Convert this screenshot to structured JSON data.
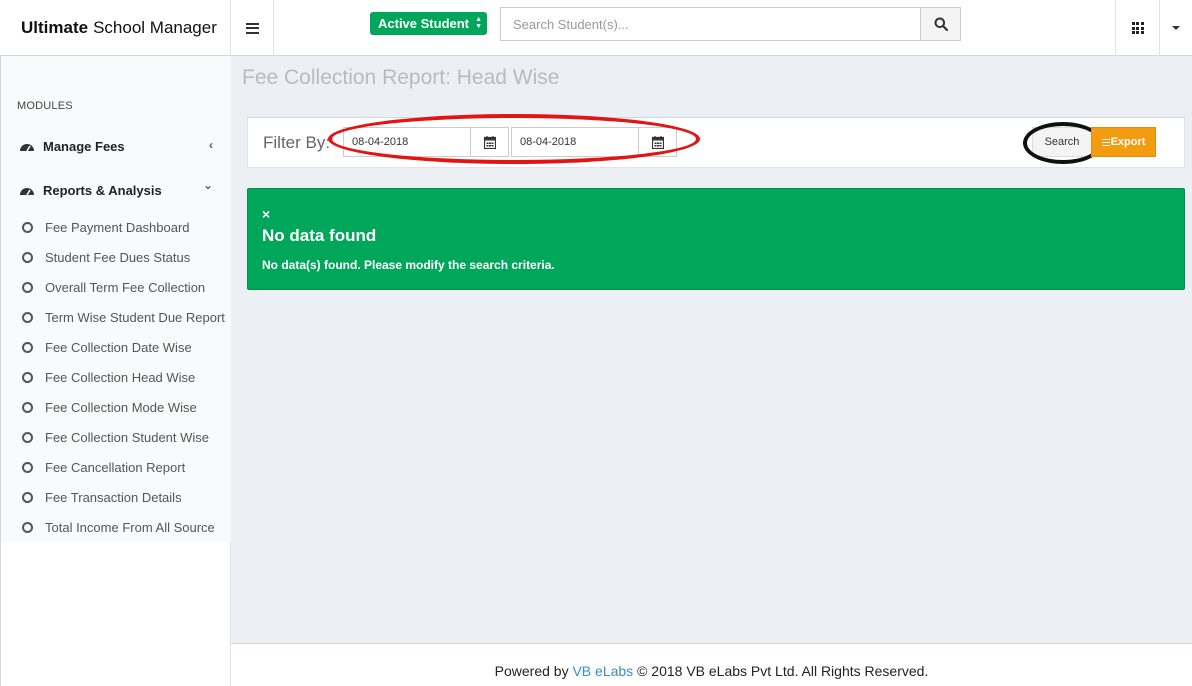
{
  "header": {
    "brand_bold": "Ultimate",
    "brand_rest": "School Manager",
    "status_select": "Active Student",
    "search_placeholder": "Search Student(s)...",
    "icons": [
      "menu-icon",
      "search-icon",
      "apps-grid-icon",
      "caret-down-icon"
    ]
  },
  "sidebar": {
    "section_title": "MODULES",
    "tree": [
      {
        "label": "Manage Fees",
        "chevron": "‹",
        "icon": "dashboard-icon"
      },
      {
        "label": "Reports & Analysis",
        "chevron": "⌄",
        "icon": "dashboard-icon"
      }
    ],
    "items": [
      {
        "label": "Fee Payment Dashboard"
      },
      {
        "label": "Student Fee Dues Status"
      },
      {
        "label": "Overall Term Fee Collection"
      },
      {
        "label": "Term Wise Student Due Report"
      },
      {
        "label": "Fee Collection Date Wise"
      },
      {
        "label": "Fee Collection Head Wise"
      },
      {
        "label": "Fee Collection Mode Wise"
      },
      {
        "label": "Fee Collection Student Wise"
      },
      {
        "label": "Fee Cancellation Report"
      },
      {
        "label": "Fee Transaction Details"
      },
      {
        "label": "Total Income From All Source"
      }
    ]
  },
  "main": {
    "page_title": "Fee Collection Report: Head Wise",
    "filter": {
      "label": "Filter By:",
      "from_date": "08-04-2018",
      "to_date": "08-04-2018",
      "search_label": "Search",
      "export_label": "Export"
    },
    "alert": {
      "close": "×",
      "title": "No data found",
      "message": "No data(s) found. Please modify the search criteria."
    }
  },
  "footer": {
    "prefix": "Powered by",
    "link": "VB eLabs",
    "suffix": "© 2018 VB eLabs Pvt Ltd. All Rights Reserved."
  },
  "colors": {
    "success": "#00a65a",
    "warning": "#f39c12",
    "link": "#3c8dbc",
    "annotation_red": "#e31414",
    "annotation_black": "#111111"
  }
}
